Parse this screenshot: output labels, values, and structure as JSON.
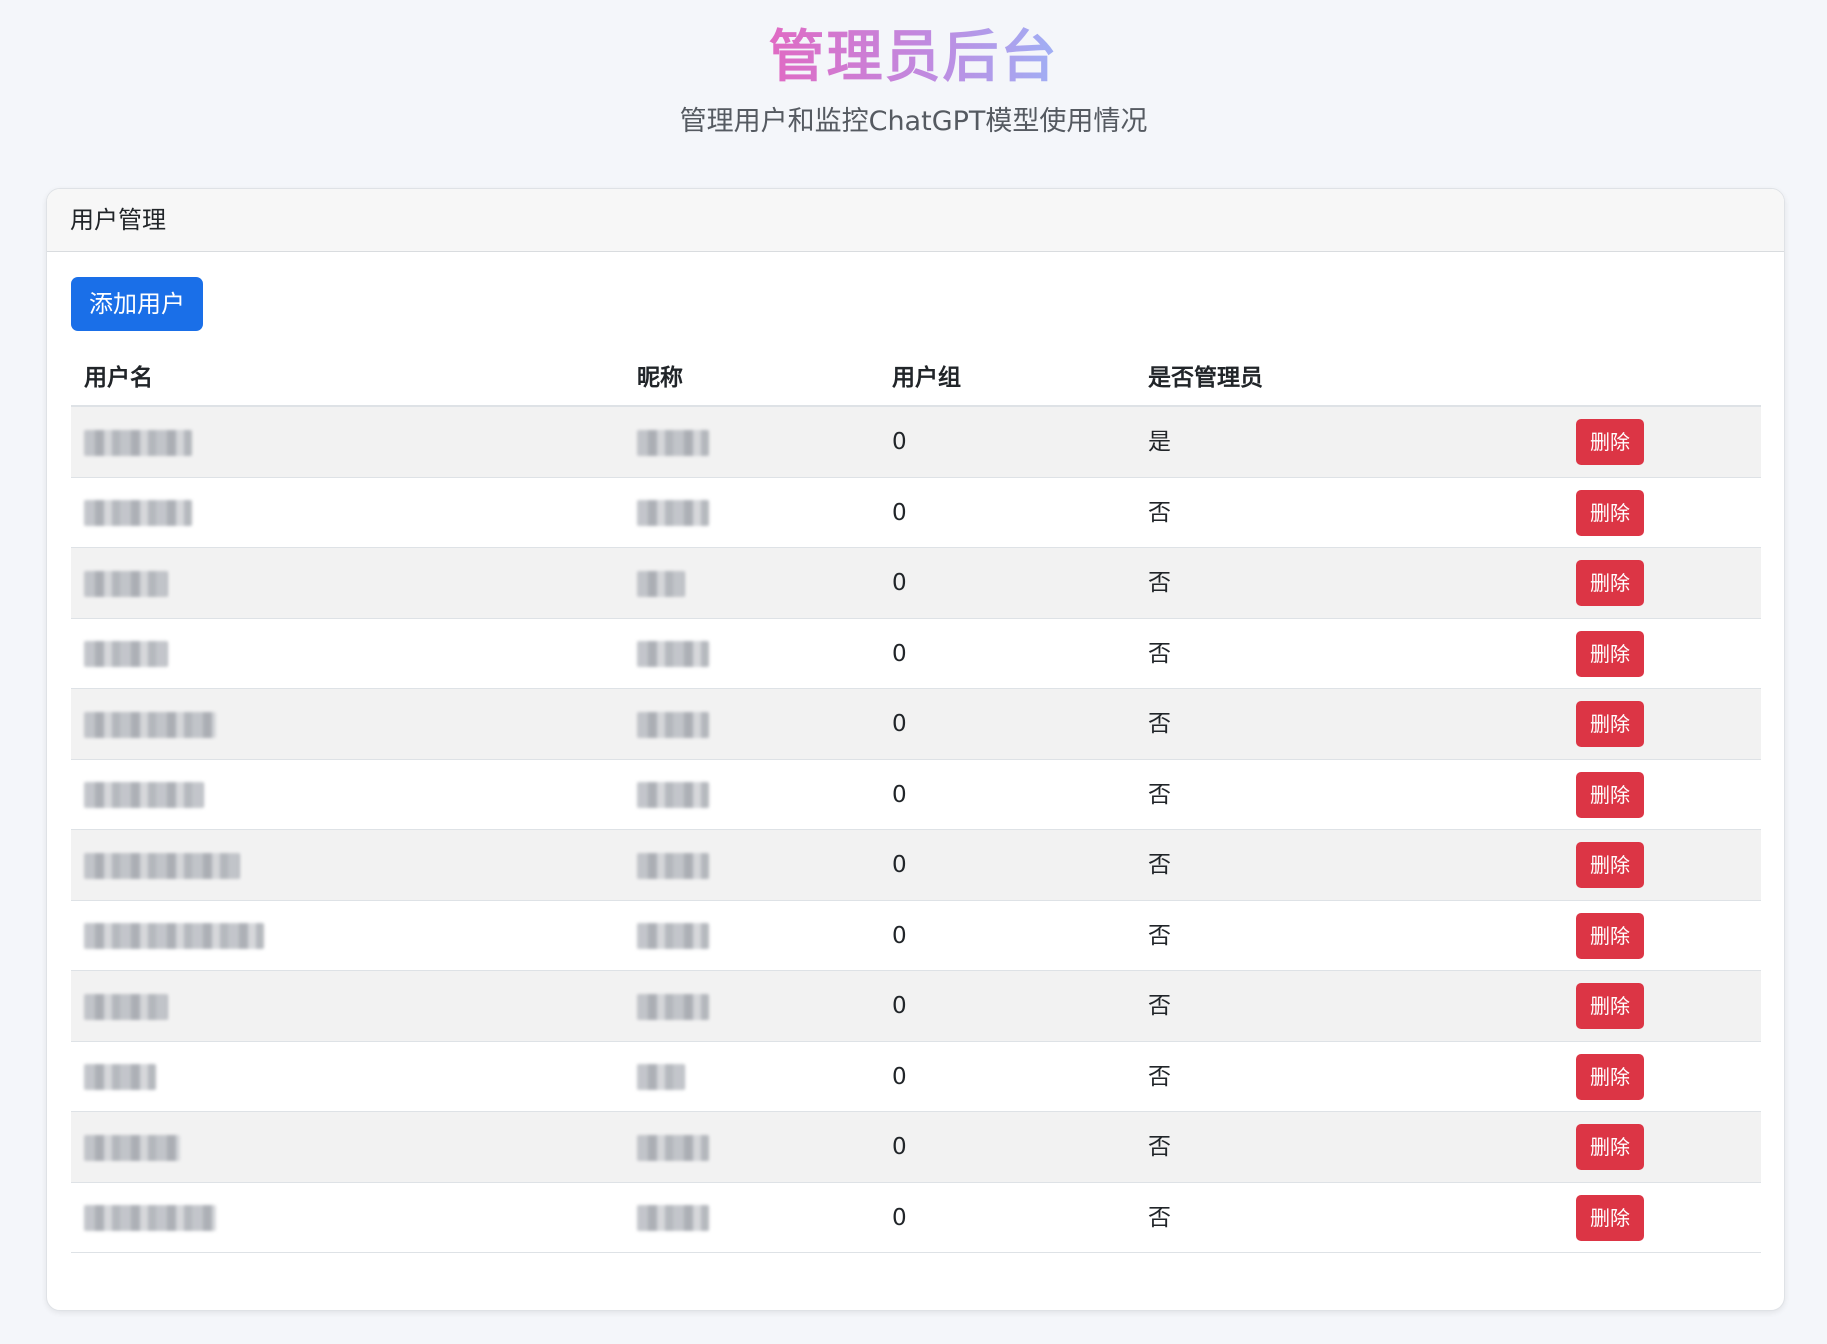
{
  "header": {
    "title": "管理员后台",
    "subtitle": "管理用户和监控ChatGPT模型使用情况"
  },
  "card": {
    "title": "用户管理",
    "add_button_label": "添加用户"
  },
  "table": {
    "columns": [
      "用户名",
      "昵称",
      "用户组",
      "是否管理员"
    ],
    "delete_label": "删除",
    "rows": [
      {
        "group": "0",
        "is_admin": "是"
      },
      {
        "group": "0",
        "is_admin": "否"
      },
      {
        "group": "0",
        "is_admin": "否"
      },
      {
        "group": "0",
        "is_admin": "否"
      },
      {
        "group": "0",
        "is_admin": "否"
      },
      {
        "group": "0",
        "is_admin": "否"
      },
      {
        "group": "0",
        "is_admin": "否"
      },
      {
        "group": "0",
        "is_admin": "否"
      },
      {
        "group": "0",
        "is_admin": "否"
      },
      {
        "group": "0",
        "is_admin": "否"
      },
      {
        "group": "0",
        "is_admin": "否"
      },
      {
        "group": "0",
        "is_admin": "否"
      }
    ]
  },
  "colors": {
    "primary": "#1a6fe8",
    "danger": "#dc3545",
    "title_gradient_start": "#e06ac3",
    "title_gradient_end": "#9fb0f5"
  }
}
